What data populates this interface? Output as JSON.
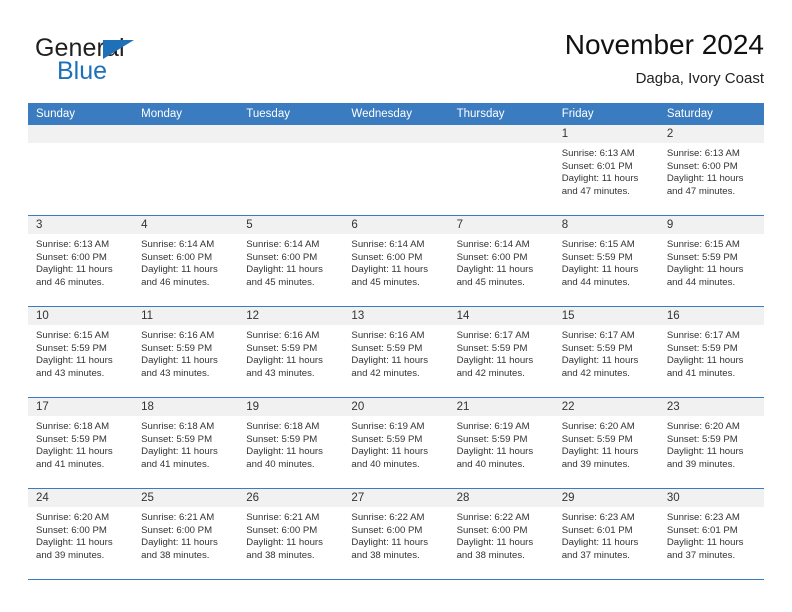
{
  "brand": {
    "name_part1": "General",
    "name_part2": "Blue",
    "triangle_color": "#1e70b8"
  },
  "header": {
    "title": "November 2024",
    "subtitle": "Dagba, Ivory Coast"
  },
  "calendar": {
    "header_bg": "#3a7cbf",
    "daynum_bg": "#f1f1f1",
    "weekdays": [
      "Sunday",
      "Monday",
      "Tuesday",
      "Wednesday",
      "Thursday",
      "Friday",
      "Saturday"
    ],
    "weeks": [
      [
        {
          "day": "",
          "sunrise": "",
          "sunset": "",
          "daylight1": "",
          "daylight2": ""
        },
        {
          "day": "",
          "sunrise": "",
          "sunset": "",
          "daylight1": "",
          "daylight2": ""
        },
        {
          "day": "",
          "sunrise": "",
          "sunset": "",
          "daylight1": "",
          "daylight2": ""
        },
        {
          "day": "",
          "sunrise": "",
          "sunset": "",
          "daylight1": "",
          "daylight2": ""
        },
        {
          "day": "",
          "sunrise": "",
          "sunset": "",
          "daylight1": "",
          "daylight2": ""
        },
        {
          "day": "1",
          "sunrise": "Sunrise: 6:13 AM",
          "sunset": "Sunset: 6:01 PM",
          "daylight1": "Daylight: 11 hours",
          "daylight2": "and 47 minutes."
        },
        {
          "day": "2",
          "sunrise": "Sunrise: 6:13 AM",
          "sunset": "Sunset: 6:00 PM",
          "daylight1": "Daylight: 11 hours",
          "daylight2": "and 47 minutes."
        }
      ],
      [
        {
          "day": "3",
          "sunrise": "Sunrise: 6:13 AM",
          "sunset": "Sunset: 6:00 PM",
          "daylight1": "Daylight: 11 hours",
          "daylight2": "and 46 minutes."
        },
        {
          "day": "4",
          "sunrise": "Sunrise: 6:14 AM",
          "sunset": "Sunset: 6:00 PM",
          "daylight1": "Daylight: 11 hours",
          "daylight2": "and 46 minutes."
        },
        {
          "day": "5",
          "sunrise": "Sunrise: 6:14 AM",
          "sunset": "Sunset: 6:00 PM",
          "daylight1": "Daylight: 11 hours",
          "daylight2": "and 45 minutes."
        },
        {
          "day": "6",
          "sunrise": "Sunrise: 6:14 AM",
          "sunset": "Sunset: 6:00 PM",
          "daylight1": "Daylight: 11 hours",
          "daylight2": "and 45 minutes."
        },
        {
          "day": "7",
          "sunrise": "Sunrise: 6:14 AM",
          "sunset": "Sunset: 6:00 PM",
          "daylight1": "Daylight: 11 hours",
          "daylight2": "and 45 minutes."
        },
        {
          "day": "8",
          "sunrise": "Sunrise: 6:15 AM",
          "sunset": "Sunset: 5:59 PM",
          "daylight1": "Daylight: 11 hours",
          "daylight2": "and 44 minutes."
        },
        {
          "day": "9",
          "sunrise": "Sunrise: 6:15 AM",
          "sunset": "Sunset: 5:59 PM",
          "daylight1": "Daylight: 11 hours",
          "daylight2": "and 44 minutes."
        }
      ],
      [
        {
          "day": "10",
          "sunrise": "Sunrise: 6:15 AM",
          "sunset": "Sunset: 5:59 PM",
          "daylight1": "Daylight: 11 hours",
          "daylight2": "and 43 minutes."
        },
        {
          "day": "11",
          "sunrise": "Sunrise: 6:16 AM",
          "sunset": "Sunset: 5:59 PM",
          "daylight1": "Daylight: 11 hours",
          "daylight2": "and 43 minutes."
        },
        {
          "day": "12",
          "sunrise": "Sunrise: 6:16 AM",
          "sunset": "Sunset: 5:59 PM",
          "daylight1": "Daylight: 11 hours",
          "daylight2": "and 43 minutes."
        },
        {
          "day": "13",
          "sunrise": "Sunrise: 6:16 AM",
          "sunset": "Sunset: 5:59 PM",
          "daylight1": "Daylight: 11 hours",
          "daylight2": "and 42 minutes."
        },
        {
          "day": "14",
          "sunrise": "Sunrise: 6:17 AM",
          "sunset": "Sunset: 5:59 PM",
          "daylight1": "Daylight: 11 hours",
          "daylight2": "and 42 minutes."
        },
        {
          "day": "15",
          "sunrise": "Sunrise: 6:17 AM",
          "sunset": "Sunset: 5:59 PM",
          "daylight1": "Daylight: 11 hours",
          "daylight2": "and 42 minutes."
        },
        {
          "day": "16",
          "sunrise": "Sunrise: 6:17 AM",
          "sunset": "Sunset: 5:59 PM",
          "daylight1": "Daylight: 11 hours",
          "daylight2": "and 41 minutes."
        }
      ],
      [
        {
          "day": "17",
          "sunrise": "Sunrise: 6:18 AM",
          "sunset": "Sunset: 5:59 PM",
          "daylight1": "Daylight: 11 hours",
          "daylight2": "and 41 minutes."
        },
        {
          "day": "18",
          "sunrise": "Sunrise: 6:18 AM",
          "sunset": "Sunset: 5:59 PM",
          "daylight1": "Daylight: 11 hours",
          "daylight2": "and 41 minutes."
        },
        {
          "day": "19",
          "sunrise": "Sunrise: 6:18 AM",
          "sunset": "Sunset: 5:59 PM",
          "daylight1": "Daylight: 11 hours",
          "daylight2": "and 40 minutes."
        },
        {
          "day": "20",
          "sunrise": "Sunrise: 6:19 AM",
          "sunset": "Sunset: 5:59 PM",
          "daylight1": "Daylight: 11 hours",
          "daylight2": "and 40 minutes."
        },
        {
          "day": "21",
          "sunrise": "Sunrise: 6:19 AM",
          "sunset": "Sunset: 5:59 PM",
          "daylight1": "Daylight: 11 hours",
          "daylight2": "and 40 minutes."
        },
        {
          "day": "22",
          "sunrise": "Sunrise: 6:20 AM",
          "sunset": "Sunset: 5:59 PM",
          "daylight1": "Daylight: 11 hours",
          "daylight2": "and 39 minutes."
        },
        {
          "day": "23",
          "sunrise": "Sunrise: 6:20 AM",
          "sunset": "Sunset: 5:59 PM",
          "daylight1": "Daylight: 11 hours",
          "daylight2": "and 39 minutes."
        }
      ],
      [
        {
          "day": "24",
          "sunrise": "Sunrise: 6:20 AM",
          "sunset": "Sunset: 6:00 PM",
          "daylight1": "Daylight: 11 hours",
          "daylight2": "and 39 minutes."
        },
        {
          "day": "25",
          "sunrise": "Sunrise: 6:21 AM",
          "sunset": "Sunset: 6:00 PM",
          "daylight1": "Daylight: 11 hours",
          "daylight2": "and 38 minutes."
        },
        {
          "day": "26",
          "sunrise": "Sunrise: 6:21 AM",
          "sunset": "Sunset: 6:00 PM",
          "daylight1": "Daylight: 11 hours",
          "daylight2": "and 38 minutes."
        },
        {
          "day": "27",
          "sunrise": "Sunrise: 6:22 AM",
          "sunset": "Sunset: 6:00 PM",
          "daylight1": "Daylight: 11 hours",
          "daylight2": "and 38 minutes."
        },
        {
          "day": "28",
          "sunrise": "Sunrise: 6:22 AM",
          "sunset": "Sunset: 6:00 PM",
          "daylight1": "Daylight: 11 hours",
          "daylight2": "and 38 minutes."
        },
        {
          "day": "29",
          "sunrise": "Sunrise: 6:23 AM",
          "sunset": "Sunset: 6:01 PM",
          "daylight1": "Daylight: 11 hours",
          "daylight2": "and 37 minutes."
        },
        {
          "day": "30",
          "sunrise": "Sunrise: 6:23 AM",
          "sunset": "Sunset: 6:01 PM",
          "daylight1": "Daylight: 11 hours",
          "daylight2": "and 37 minutes."
        }
      ]
    ]
  }
}
